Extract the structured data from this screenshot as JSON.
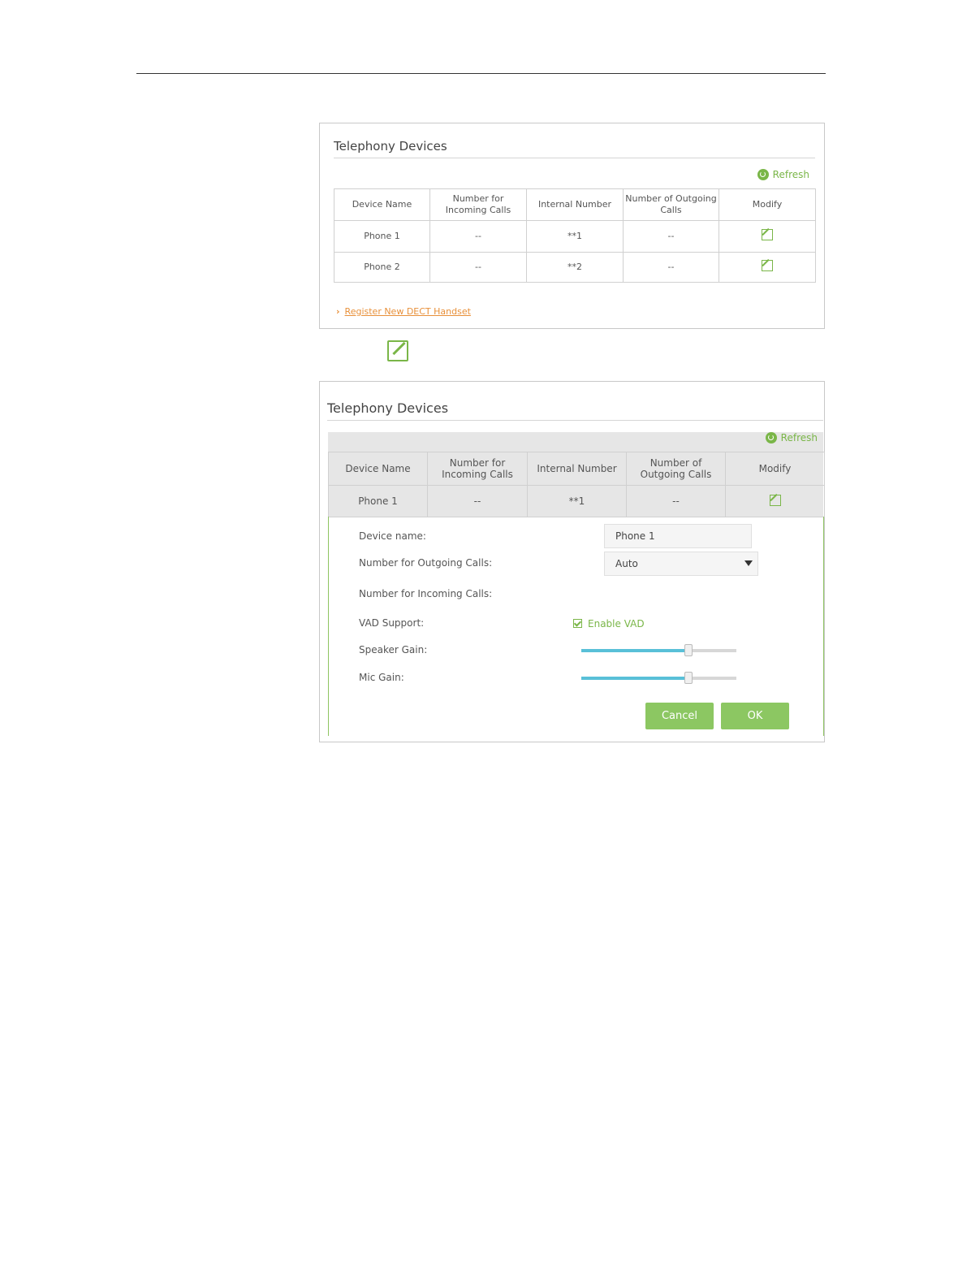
{
  "panel1": {
    "title": "Telephony Devices",
    "refresh_label": "Refresh",
    "table": {
      "headers": [
        "Device Name",
        "Number for Incoming Calls",
        "Internal Number",
        "Number of Outgoing Calls",
        "Modify"
      ],
      "rows": [
        [
          "Phone 1",
          "--",
          "**1",
          "--"
        ],
        [
          "Phone 2",
          "--",
          "**2",
          "--"
        ]
      ]
    },
    "register_link": "Register New DECT Handset"
  },
  "panel2": {
    "title": "Telephony Devices",
    "refresh_label": "Refresh",
    "table": {
      "headers": [
        "Device Name",
        "Number for Incoming Calls",
        "Internal Number",
        "Number of Outgoing Calls",
        "Modify"
      ],
      "rows": [
        [
          "Phone 1",
          "--",
          "**1",
          "--"
        ]
      ]
    },
    "form": {
      "device_name_label": "Device name:",
      "device_name_value": "Phone 1",
      "outgoing_label": "Number for Outgoing Calls:",
      "outgoing_value": "Auto",
      "incoming_label": "Number for Incoming Calls:",
      "vad_label": "VAD Support:",
      "vad_checkbox_label": "Enable VAD",
      "vad_checked": true,
      "speaker_gain_label": "Speaker Gain:",
      "speaker_gain_fraction": 0.69,
      "mic_gain_label": "Mic Gain:",
      "mic_gain_fraction": 0.69,
      "cancel_label": "Cancel",
      "ok_label": "OK"
    }
  },
  "colors": {
    "accent_green": "#7ab648",
    "button_green": "#8cc762",
    "link_orange": "#e8903a",
    "slider_fill": "#59c0d8"
  }
}
